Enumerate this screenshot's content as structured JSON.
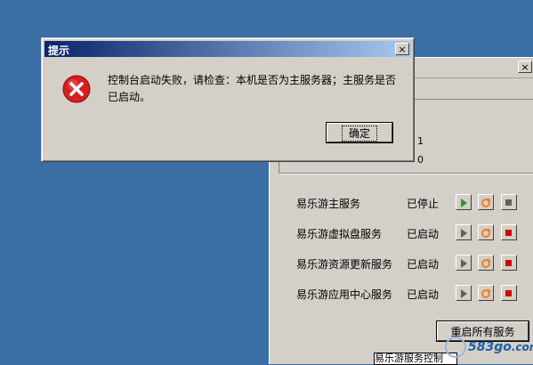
{
  "dialog": {
    "title": "提示",
    "message": "控制台启动失败，请检查：本机是否为主服务器；主服务是否已启动。",
    "ok_label": "确定",
    "close_glyph": "×",
    "icon": "error-icon"
  },
  "panel": {
    "close_glyph": "×",
    "info_values": [
      "1",
      "0"
    ],
    "services": [
      {
        "name": "易乐游主服务",
        "status": "已停止"
      },
      {
        "name": "易乐游虚拟盘服务",
        "status": "已启动"
      },
      {
        "name": "易乐游资源更新服务",
        "status": "已启动"
      },
      {
        "name": "易乐游应用中心服务",
        "status": "已启动"
      }
    ],
    "restart_all_label": "重启所有服务"
  },
  "taskbar": {
    "label": "易乐游服务控制"
  },
  "watermark": {
    "text": "583go",
    "domain": ".com"
  },
  "colors": {
    "desktop": "#3a6ea5",
    "title_start": "#0a246a",
    "title_end": "#a6caf0",
    "play_green": "#2a9a2a",
    "stop_red": "#d40000",
    "restart_orange": "#f08020"
  }
}
